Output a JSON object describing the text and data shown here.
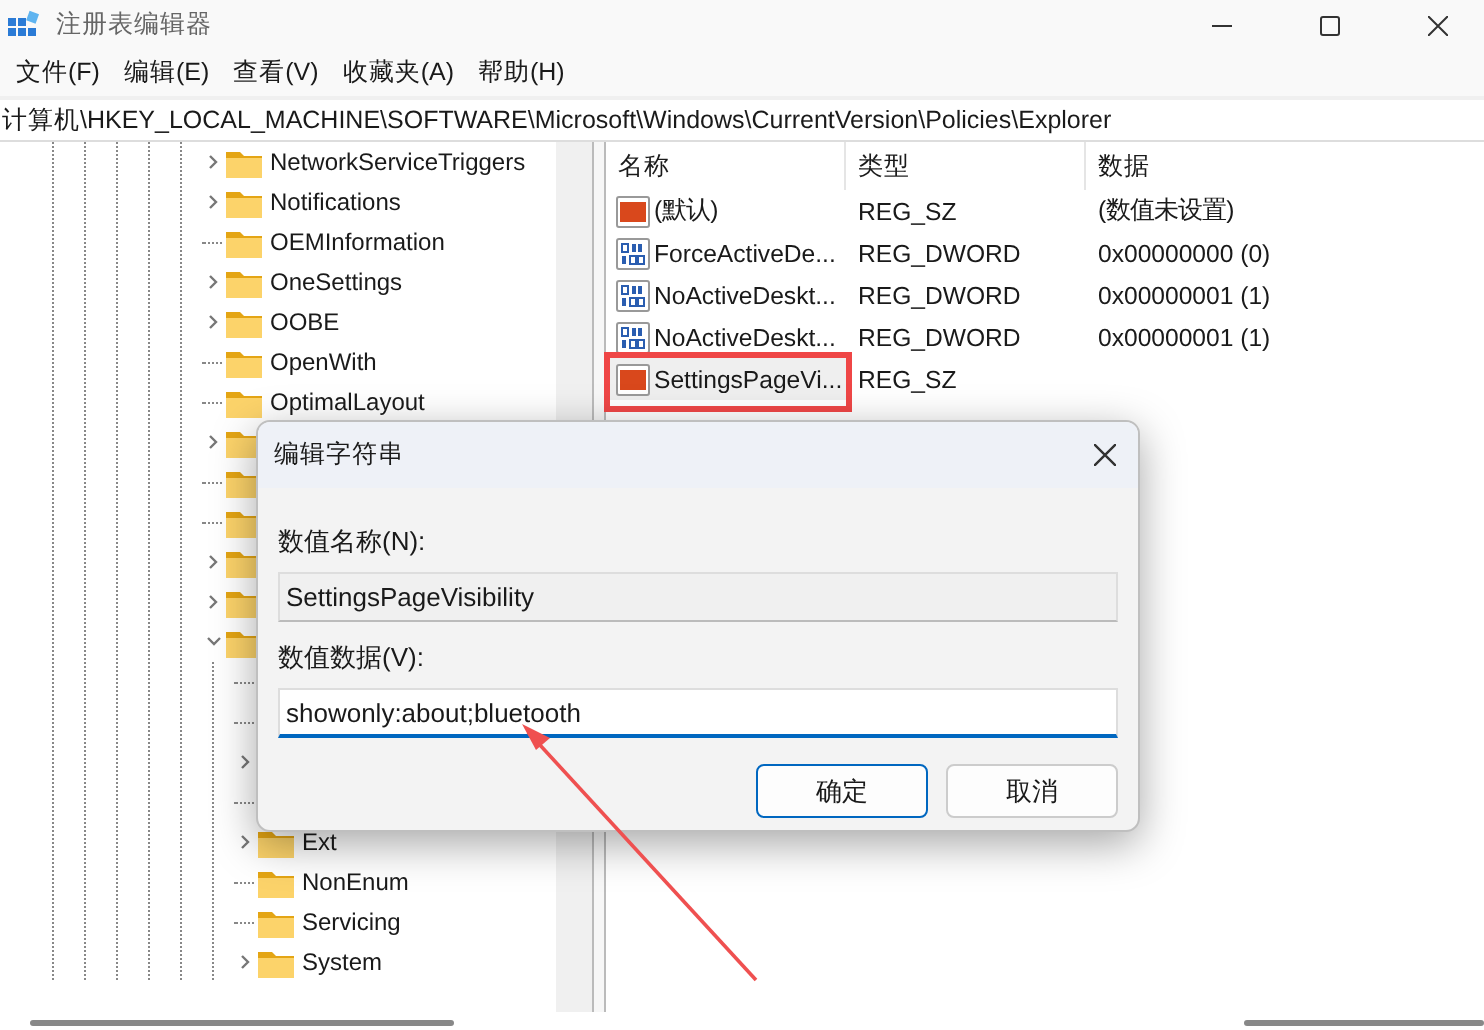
{
  "window": {
    "title": "注册表编辑器"
  },
  "menu": [
    "文件(F)",
    "编辑(E)",
    "查看(V)",
    "收藏夹(A)",
    "帮助(H)"
  ],
  "address": "计算机\\HKEY_LOCAL_MACHINE\\SOFTWARE\\Microsoft\\Windows\\CurrentVersion\\Policies\\Explorer",
  "tree": [
    {
      "kind": "branch",
      "label": "NetworkServiceTriggers",
      "expanded": false
    },
    {
      "kind": "branch",
      "label": "Notifications",
      "expanded": false
    },
    {
      "kind": "leaf",
      "label": "OEMInformation"
    },
    {
      "kind": "branch",
      "label": "OneSettings",
      "expanded": false
    },
    {
      "kind": "branch",
      "label": "OOBE",
      "expanded": false
    },
    {
      "kind": "leaf",
      "label": "OpenWith"
    },
    {
      "kind": "leaf",
      "label": "OptimalLayout"
    },
    {
      "kind": "branch",
      "expanded": false
    },
    {
      "kind": "leaf"
    },
    {
      "kind": "leaf"
    },
    {
      "kind": "branch",
      "expanded": false
    },
    {
      "kind": "branch",
      "expanded": false
    },
    {
      "kind": "branch",
      "expanded": true,
      "children": [
        {
          "kind": "leaf"
        },
        {
          "kind": "leaf"
        },
        {
          "kind": "branch",
          "expanded": false
        },
        {
          "kind": "leaf"
        },
        {
          "kind": "branch",
          "label": "Ext",
          "expanded": false
        },
        {
          "kind": "leaf",
          "label": "NonEnum"
        },
        {
          "kind": "leaf",
          "label": "Servicing"
        },
        {
          "kind": "branch",
          "label": "System",
          "expanded": false
        }
      ]
    }
  ],
  "columns": [
    "名称",
    "类型",
    "数据"
  ],
  "values": [
    {
      "kind": "string",
      "name": "(默认)",
      "type": "REG_SZ",
      "data": "(数值未设置)",
      "selected": false
    },
    {
      "kind": "binary",
      "name": "ForceActiveDe...",
      "type": "REG_DWORD",
      "data": "0x00000000 (0)",
      "selected": false
    },
    {
      "kind": "binary",
      "name": "NoActiveDeskt...",
      "type": "REG_DWORD",
      "data": "0x00000001 (1)",
      "selected": false
    },
    {
      "kind": "binary",
      "name": "NoActiveDeskt...",
      "type": "REG_DWORD",
      "data": "0x00000001 (1)",
      "selected": false
    },
    {
      "kind": "string",
      "name": "SettingsPageVi...",
      "type": "REG_SZ",
      "selected": true
    }
  ],
  "dialog": {
    "title": "编辑字符串",
    "name_label": "数值名称(N):",
    "name_value": "SettingsPageVisibility",
    "data_label": "数值数据(V):",
    "data_value": "showonly:about;bluetooth",
    "buttons": [
      {
        "label": "确定",
        "default": true
      },
      {
        "label": "取消",
        "default": false
      }
    ]
  }
}
